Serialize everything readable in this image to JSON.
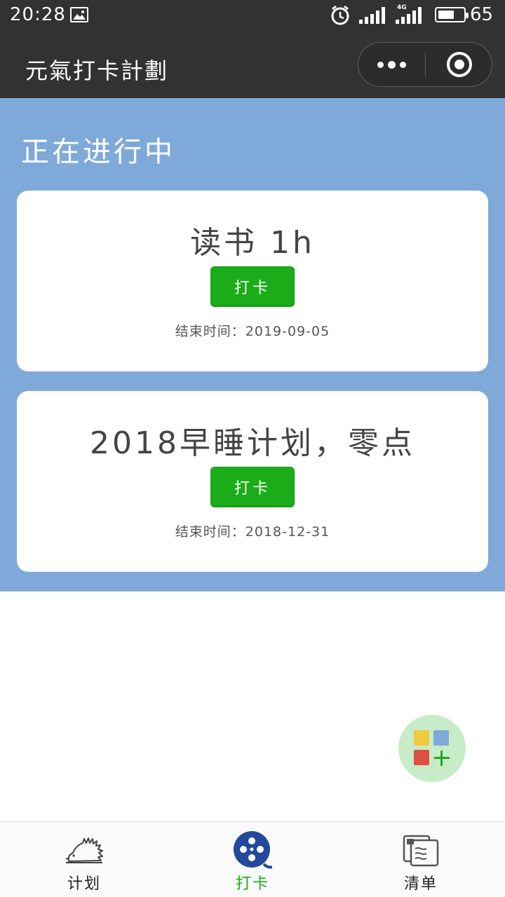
{
  "status_bar": {
    "time": "20:28",
    "network": "4G",
    "battery": "65",
    "battery_level": 0.65
  },
  "navbar": {
    "title": "元氣打卡計劃"
  },
  "main": {
    "section_title": "正在进行中",
    "plans": [
      {
        "title": "读书 1h",
        "button_label": "打卡",
        "end_label": "结束时间：",
        "end_date": "2019-09-05"
      },
      {
        "title": "2018早睡计划，零点",
        "button_label": "打卡",
        "end_label": "结束时间：",
        "end_date": "2018-12-31"
      }
    ]
  },
  "tabbar": {
    "items": [
      {
        "label": "计划",
        "icon": "hedgehog-icon",
        "active": false
      },
      {
        "label": "打卡",
        "icon": "film-reel-icon",
        "active": true
      },
      {
        "label": "清单",
        "icon": "list-card-icon",
        "active": false
      }
    ]
  },
  "colors": {
    "nav_bg": "#333132",
    "main_bg": "#7fa9d9",
    "button_green": "#1aad19",
    "active_tab": "#1aad19",
    "fab_bg": "#c8ecc8"
  }
}
